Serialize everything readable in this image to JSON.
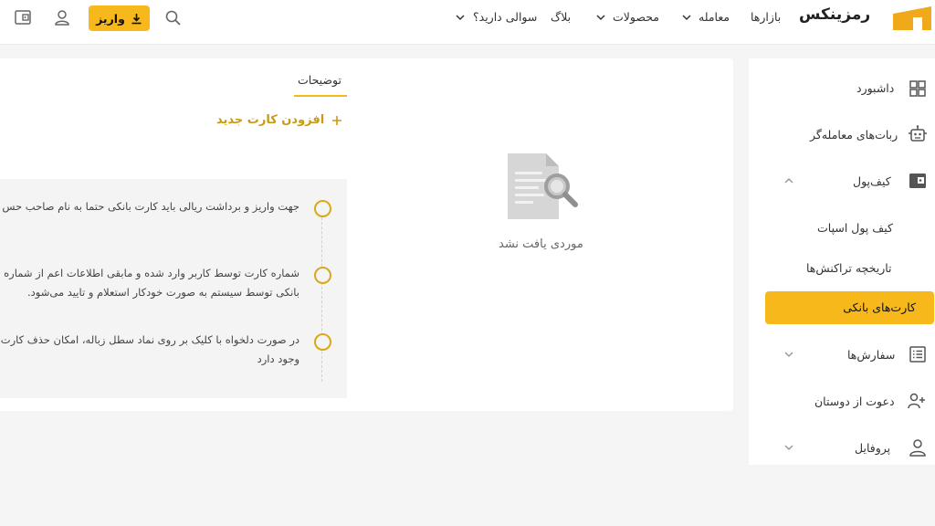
{
  "header": {
    "logo_text": "رمزینکس",
    "nav": {
      "markets": "بازارها",
      "trade": "معامله",
      "products": "محصولات",
      "blog": "بلاگ",
      "faq": "سوالی دارید؟"
    },
    "deposit_label": "واریز"
  },
  "sidebar": {
    "dashboard": "داشبورد",
    "bots": "ربات‌های معامله‌گر",
    "wallet": "کیف‌پول",
    "spot_wallet": "کیف پول اسپات",
    "transactions": "تاریخچه تراکنش‌ها",
    "bank_cards": "کارت‌های بانکی",
    "orders": "سفارش‌ها",
    "invite": "دعوت از دوستان",
    "profile": "پروفایل"
  },
  "main": {
    "tab_label": "توضیحات",
    "add_card_label": "افزودن کارت جدید",
    "empty_text": "موردی یافت نشد",
    "info": {
      "item1_line1": "جهت واریز و برداشت ریالی باید کارت بانکی حتما به نام صاحب حس",
      "item2_line1": "شماره کارت توسط کاربر وارد شده و مابقی اطلاعات اعم از شماره شب",
      "item2_line2": "بانکی توسط سیستم به صورت خودکار استعلام و تایید می‌شود.",
      "item3_line1": "در صورت دلخواه با کلیک بر روی نماد سطل زباله، امکان حذف کارت",
      "item3_line2": "وجود دارد"
    }
  },
  "colors": {
    "accent": "#f7b81c",
    "accent_text": "#c99a12",
    "logo": "#f0a91b"
  }
}
